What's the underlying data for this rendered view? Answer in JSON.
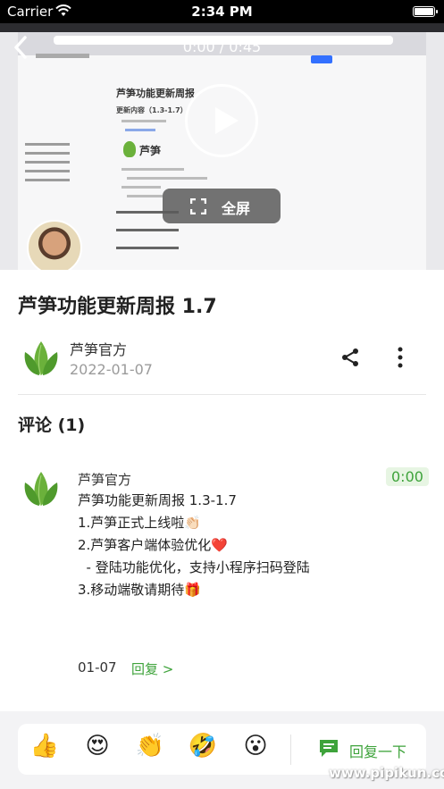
{
  "status_bar": {
    "carrier": "Carrier",
    "time": "2:34 PM"
  },
  "video": {
    "time_display": "0:00 / 0:45",
    "fullscreen_label": "全屏"
  },
  "recording": {
    "doc_heading": "芦笋功能更新周报",
    "doc_section": "更新内容（1.3-1.7）",
    "logo_text": "芦笋"
  },
  "post": {
    "title": "芦笋功能更新周报 1.7",
    "author": "芦笋官方",
    "date": "2022-01-07"
  },
  "comments": {
    "header": "评论 (1)",
    "items": [
      {
        "author": "芦笋官方",
        "timestamp": "0:00",
        "lines": [
          "芦笋功能更新周报 1.3-1.7",
          "1.芦笋正式上线啦👏🏻",
          "2.芦笋客户端体验优化❤️",
          "  - 登陆功能优化，支持小程序扫码登陆",
          "3.移动端敬请期待🎁"
        ],
        "date": "01-07",
        "reply_label": "回复 >"
      }
    ]
  },
  "reactions": {
    "emojis": [
      "👍",
      "😍",
      "👏",
      "🤣",
      "😮"
    ],
    "reply_label": "回复一下"
  },
  "watermark": "www.pipikun.com",
  "colors": {
    "accent_green": "#3ea33b",
    "leaf_green": "#6bb13b"
  }
}
